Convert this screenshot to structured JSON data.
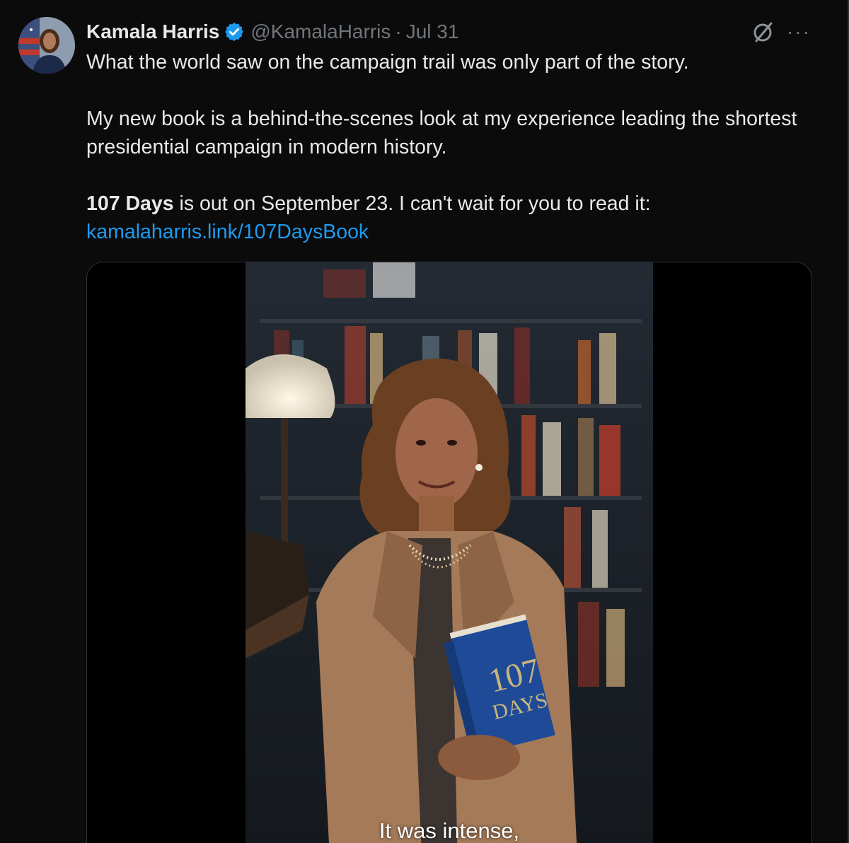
{
  "tweet": {
    "author_name": "Kamala Harris",
    "handle": "@KamalaHarris",
    "separator": "·",
    "date": "Jul 31",
    "verified": true,
    "more_icon": "···",
    "paragraph1": "What the world saw on the campaign trail was only part of the story.",
    "paragraph2": "My new book is a behind-the-scenes look at my experience leading the shortest presidential campaign in modern history.",
    "book_title": "107 Days",
    "paragraph3_rest": " is out on September 23. I can't wait for you to read it:",
    "link": "kamalaharris.link/107DaysBook"
  },
  "media": {
    "type": "video",
    "caption": "It was intense,",
    "book_cover_text": "107 DAYS"
  },
  "colors": {
    "background": "#0b0b0b",
    "text": "#e7e9ea",
    "secondary": "#71767b",
    "link": "#1d9bf0",
    "verified": "#1d9bf0"
  }
}
